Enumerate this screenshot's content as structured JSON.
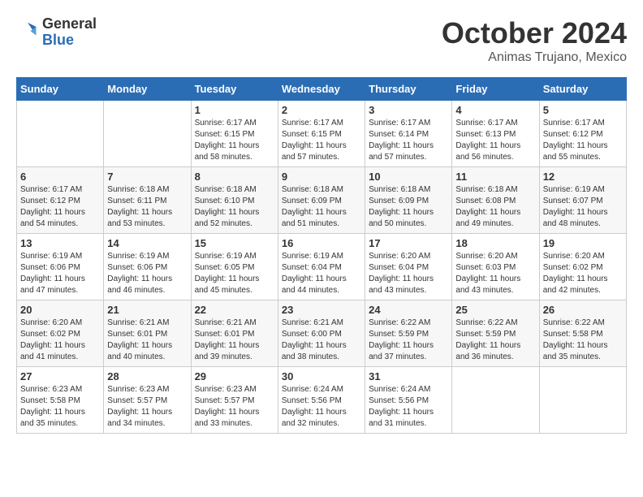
{
  "logo": {
    "general": "General",
    "blue": "Blue"
  },
  "title": "October 2024",
  "location": "Animas Trujano, Mexico",
  "weekdays": [
    "Sunday",
    "Monday",
    "Tuesday",
    "Wednesday",
    "Thursday",
    "Friday",
    "Saturday"
  ],
  "weeks": [
    [
      {
        "day": "",
        "sunrise": "",
        "sunset": "",
        "daylight": ""
      },
      {
        "day": "",
        "sunrise": "",
        "sunset": "",
        "daylight": ""
      },
      {
        "day": "1",
        "sunrise": "Sunrise: 6:17 AM",
        "sunset": "Sunset: 6:15 PM",
        "daylight": "Daylight: 11 hours and 58 minutes."
      },
      {
        "day": "2",
        "sunrise": "Sunrise: 6:17 AM",
        "sunset": "Sunset: 6:15 PM",
        "daylight": "Daylight: 11 hours and 57 minutes."
      },
      {
        "day": "3",
        "sunrise": "Sunrise: 6:17 AM",
        "sunset": "Sunset: 6:14 PM",
        "daylight": "Daylight: 11 hours and 57 minutes."
      },
      {
        "day": "4",
        "sunrise": "Sunrise: 6:17 AM",
        "sunset": "Sunset: 6:13 PM",
        "daylight": "Daylight: 11 hours and 56 minutes."
      },
      {
        "day": "5",
        "sunrise": "Sunrise: 6:17 AM",
        "sunset": "Sunset: 6:12 PM",
        "daylight": "Daylight: 11 hours and 55 minutes."
      }
    ],
    [
      {
        "day": "6",
        "sunrise": "Sunrise: 6:17 AM",
        "sunset": "Sunset: 6:12 PM",
        "daylight": "Daylight: 11 hours and 54 minutes."
      },
      {
        "day": "7",
        "sunrise": "Sunrise: 6:18 AM",
        "sunset": "Sunset: 6:11 PM",
        "daylight": "Daylight: 11 hours and 53 minutes."
      },
      {
        "day": "8",
        "sunrise": "Sunrise: 6:18 AM",
        "sunset": "Sunset: 6:10 PM",
        "daylight": "Daylight: 11 hours and 52 minutes."
      },
      {
        "day": "9",
        "sunrise": "Sunrise: 6:18 AM",
        "sunset": "Sunset: 6:09 PM",
        "daylight": "Daylight: 11 hours and 51 minutes."
      },
      {
        "day": "10",
        "sunrise": "Sunrise: 6:18 AM",
        "sunset": "Sunset: 6:09 PM",
        "daylight": "Daylight: 11 hours and 50 minutes."
      },
      {
        "day": "11",
        "sunrise": "Sunrise: 6:18 AM",
        "sunset": "Sunset: 6:08 PM",
        "daylight": "Daylight: 11 hours and 49 minutes."
      },
      {
        "day": "12",
        "sunrise": "Sunrise: 6:19 AM",
        "sunset": "Sunset: 6:07 PM",
        "daylight": "Daylight: 11 hours and 48 minutes."
      }
    ],
    [
      {
        "day": "13",
        "sunrise": "Sunrise: 6:19 AM",
        "sunset": "Sunset: 6:06 PM",
        "daylight": "Daylight: 11 hours and 47 minutes."
      },
      {
        "day": "14",
        "sunrise": "Sunrise: 6:19 AM",
        "sunset": "Sunset: 6:06 PM",
        "daylight": "Daylight: 11 hours and 46 minutes."
      },
      {
        "day": "15",
        "sunrise": "Sunrise: 6:19 AM",
        "sunset": "Sunset: 6:05 PM",
        "daylight": "Daylight: 11 hours and 45 minutes."
      },
      {
        "day": "16",
        "sunrise": "Sunrise: 6:19 AM",
        "sunset": "Sunset: 6:04 PM",
        "daylight": "Daylight: 11 hours and 44 minutes."
      },
      {
        "day": "17",
        "sunrise": "Sunrise: 6:20 AM",
        "sunset": "Sunset: 6:04 PM",
        "daylight": "Daylight: 11 hours and 43 minutes."
      },
      {
        "day": "18",
        "sunrise": "Sunrise: 6:20 AM",
        "sunset": "Sunset: 6:03 PM",
        "daylight": "Daylight: 11 hours and 43 minutes."
      },
      {
        "day": "19",
        "sunrise": "Sunrise: 6:20 AM",
        "sunset": "Sunset: 6:02 PM",
        "daylight": "Daylight: 11 hours and 42 minutes."
      }
    ],
    [
      {
        "day": "20",
        "sunrise": "Sunrise: 6:20 AM",
        "sunset": "Sunset: 6:02 PM",
        "daylight": "Daylight: 11 hours and 41 minutes."
      },
      {
        "day": "21",
        "sunrise": "Sunrise: 6:21 AM",
        "sunset": "Sunset: 6:01 PM",
        "daylight": "Daylight: 11 hours and 40 minutes."
      },
      {
        "day": "22",
        "sunrise": "Sunrise: 6:21 AM",
        "sunset": "Sunset: 6:01 PM",
        "daylight": "Daylight: 11 hours and 39 minutes."
      },
      {
        "day": "23",
        "sunrise": "Sunrise: 6:21 AM",
        "sunset": "Sunset: 6:00 PM",
        "daylight": "Daylight: 11 hours and 38 minutes."
      },
      {
        "day": "24",
        "sunrise": "Sunrise: 6:22 AM",
        "sunset": "Sunset: 5:59 PM",
        "daylight": "Daylight: 11 hours and 37 minutes."
      },
      {
        "day": "25",
        "sunrise": "Sunrise: 6:22 AM",
        "sunset": "Sunset: 5:59 PM",
        "daylight": "Daylight: 11 hours and 36 minutes."
      },
      {
        "day": "26",
        "sunrise": "Sunrise: 6:22 AM",
        "sunset": "Sunset: 5:58 PM",
        "daylight": "Daylight: 11 hours and 35 minutes."
      }
    ],
    [
      {
        "day": "27",
        "sunrise": "Sunrise: 6:23 AM",
        "sunset": "Sunset: 5:58 PM",
        "daylight": "Daylight: 11 hours and 35 minutes."
      },
      {
        "day": "28",
        "sunrise": "Sunrise: 6:23 AM",
        "sunset": "Sunset: 5:57 PM",
        "daylight": "Daylight: 11 hours and 34 minutes."
      },
      {
        "day": "29",
        "sunrise": "Sunrise: 6:23 AM",
        "sunset": "Sunset: 5:57 PM",
        "daylight": "Daylight: 11 hours and 33 minutes."
      },
      {
        "day": "30",
        "sunrise": "Sunrise: 6:24 AM",
        "sunset": "Sunset: 5:56 PM",
        "daylight": "Daylight: 11 hours and 32 minutes."
      },
      {
        "day": "31",
        "sunrise": "Sunrise: 6:24 AM",
        "sunset": "Sunset: 5:56 PM",
        "daylight": "Daylight: 11 hours and 31 minutes."
      },
      {
        "day": "",
        "sunrise": "",
        "sunset": "",
        "daylight": ""
      },
      {
        "day": "",
        "sunrise": "",
        "sunset": "",
        "daylight": ""
      }
    ]
  ]
}
